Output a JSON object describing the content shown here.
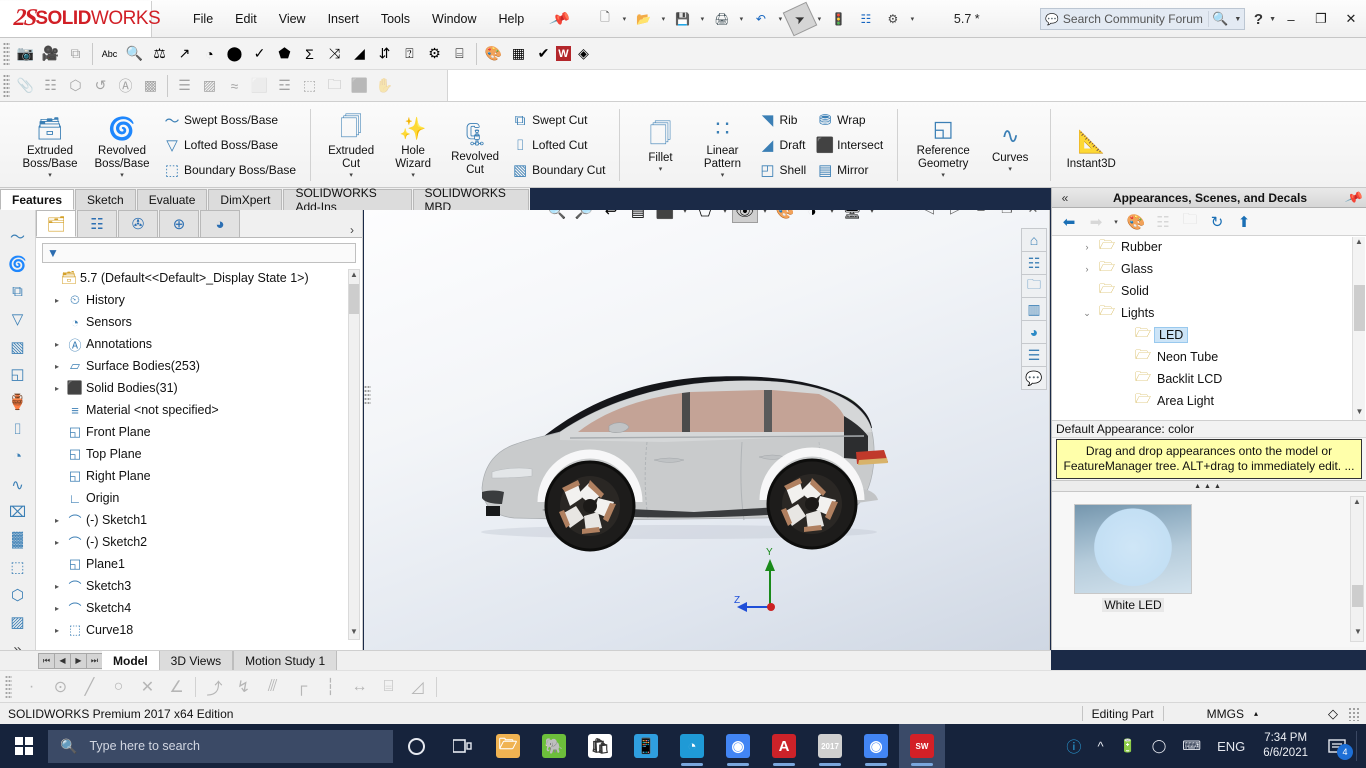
{
  "app": {
    "brand_ds": "2S",
    "brand_bold": "SOLID",
    "brand_light": "WORKS",
    "document_name": "5.7 *",
    "edition": "SOLIDWORKS Premium 2017 x64 Edition"
  },
  "menubar": {
    "items": [
      "File",
      "Edit",
      "View",
      "Insert",
      "Tools",
      "Window",
      "Help"
    ],
    "pin_icon": "pushpin-icon"
  },
  "quick_access": {
    "buttons": [
      {
        "name": "new-document",
        "icon": "new-file-icon",
        "caret": true
      },
      {
        "name": "open-document",
        "icon": "open-folder-icon",
        "caret": true
      },
      {
        "name": "save-document",
        "icon": "save-disk-icon",
        "caret": true
      },
      {
        "name": "print-document",
        "icon": "printer-icon",
        "caret": true
      },
      {
        "name": "undo",
        "icon": "undo-arrow-icon",
        "caret": true
      },
      {
        "name": "select",
        "icon": "cursor-arrow-icon",
        "caret": true,
        "selected": true
      },
      {
        "name": "rebuild",
        "icon": "traffic-light-icon",
        "caret": false
      },
      {
        "name": "file-properties",
        "icon": "properties-list-icon",
        "caret": false
      },
      {
        "name": "options",
        "icon": "gear-icon",
        "caret": true
      }
    ]
  },
  "search": {
    "placeholder": "Search Community Forum",
    "icon": "community-chat-icon",
    "magnifier": "magnifier-icon"
  },
  "window_controls": {
    "help": "?",
    "minimize": "–",
    "maximize": "❐",
    "close": "✕"
  },
  "toolbar_row1": [
    {
      "name": "capture-image-icon",
      "glyph": "📷",
      "dim": false
    },
    {
      "name": "record-video-icon",
      "glyph": "🎥",
      "dim": false
    },
    {
      "name": "copy-image-icon",
      "glyph": "⧉",
      "dim": true
    },
    {
      "name": "spell-checker-icon",
      "glyph": "Abc",
      "dim": false
    },
    {
      "name": "design-checker-icon",
      "glyph": "🔍",
      "dim": false
    },
    {
      "name": "compare-documents-icon",
      "glyph": "⚖",
      "dim": false
    },
    {
      "name": "import-diagnostics-icon",
      "glyph": "↗",
      "dim": false
    },
    {
      "name": "performance-evaluation-icon",
      "glyph": "◔",
      "dim": false
    },
    {
      "name": "mass-properties-icon",
      "glyph": "⬤",
      "dim": false
    },
    {
      "name": "check-entity-icon",
      "glyph": "✓",
      "dim": false
    },
    {
      "name": "geometry-analysis-icon",
      "glyph": "⬟",
      "dim": false
    },
    {
      "name": "measure-sum-icon",
      "glyph": "Σ",
      "dim": false
    },
    {
      "name": "deviation-analysis-icon",
      "glyph": "⤨",
      "dim": false
    },
    {
      "name": "draft-analysis-icon",
      "glyph": "◢",
      "dim": false
    },
    {
      "name": "symmetry-check-icon",
      "glyph": "⇵",
      "dim": false
    },
    {
      "name": "document-info-icon",
      "glyph": "⍰",
      "dim": false
    },
    {
      "name": "sensor-check-icon",
      "glyph": "⚙",
      "dim": false
    },
    {
      "name": "design-table-icon",
      "glyph": "⌸",
      "dim": false
    },
    {
      "name": "photoview-render-icon",
      "glyph": "🎨",
      "dim": false
    },
    {
      "name": "scene-illumination-icon",
      "glyph": "▦",
      "dim": false
    },
    {
      "name": "check-mark-icon",
      "glyph": "✔",
      "dim": false
    },
    {
      "name": "word-export-icon",
      "glyph": "W",
      "dim": false
    },
    {
      "name": "3d-interconnect-icon",
      "glyph": "◈",
      "dim": false
    }
  ],
  "toolbar_row2": [
    {
      "name": "attach-file-icon",
      "glyph": "📎"
    },
    {
      "name": "grid-layout-icon",
      "glyph": "☷"
    },
    {
      "name": "pattern-icon",
      "glyph": "⬡"
    },
    {
      "name": "cycle-icon",
      "glyph": "↺"
    },
    {
      "name": "annotate-icon",
      "glyph": "Ⓐ"
    },
    {
      "name": "texture-icon",
      "glyph": "▩"
    },
    {
      "name": "arrange-icon",
      "glyph": "☰"
    },
    {
      "name": "mesh-icon",
      "glyph": "▨"
    },
    {
      "name": "flow-icon",
      "glyph": "≈"
    },
    {
      "name": "page-icon",
      "glyph": "⬜"
    },
    {
      "name": "hierarchy-icon",
      "glyph": "☲"
    },
    {
      "name": "blank-page-icon",
      "glyph": "⬚"
    },
    {
      "name": "folder-icon",
      "glyph": "🗀"
    },
    {
      "name": "battery-icon",
      "glyph": "⬛"
    },
    {
      "name": "hand-tool-icon",
      "glyph": "✋"
    }
  ],
  "ribbon": {
    "groups": [
      {
        "name": "boss-base-group",
        "big": [
          {
            "name": "extruded-boss-base",
            "icon": "extrude-boss-icon",
            "label": "Extruded\nBoss/Base",
            "caret": true
          },
          {
            "name": "revolved-boss-base",
            "icon": "revolve-boss-icon",
            "label": "Revolved\nBoss/Base",
            "caret": true
          }
        ],
        "small": [
          {
            "name": "swept-boss-base",
            "icon": "swept-boss-icon",
            "label": "Swept Boss/Base"
          },
          {
            "name": "lofted-boss-base",
            "icon": "lofted-boss-icon",
            "label": "Lofted Boss/Base"
          },
          {
            "name": "boundary-boss-base",
            "icon": "boundary-boss-icon",
            "label": "Boundary Boss/Base"
          }
        ]
      },
      {
        "name": "cut-group",
        "big": [
          {
            "name": "extruded-cut",
            "icon": "extrude-cut-icon",
            "label": "Extruded\nCut",
            "caret": true
          },
          {
            "name": "hole-wizard",
            "icon": "hole-wizard-icon",
            "label": "Hole\nWizard",
            "caret": true
          },
          {
            "name": "revolved-cut",
            "icon": "revolve-cut-icon",
            "label": "Revolved\nCut",
            "caret": false
          }
        ],
        "small": [
          {
            "name": "swept-cut",
            "icon": "swept-cut-icon",
            "label": "Swept Cut"
          },
          {
            "name": "lofted-cut",
            "icon": "lofted-cut-icon",
            "label": "Lofted Cut"
          },
          {
            "name": "boundary-cut",
            "icon": "boundary-cut-icon",
            "label": "Boundary Cut"
          }
        ]
      },
      {
        "name": "feature-group",
        "big": [
          {
            "name": "fillet",
            "icon": "fillet-icon",
            "label": "Fillet",
            "caret": true
          },
          {
            "name": "linear-pattern",
            "icon": "linear-pattern-icon",
            "label": "Linear\nPattern",
            "caret": true
          }
        ],
        "small": [
          {
            "name": "rib",
            "icon": "rib-icon",
            "label": "Rib"
          },
          {
            "name": "draft",
            "icon": "draft-icon",
            "label": "Draft"
          },
          {
            "name": "shell",
            "icon": "shell-icon",
            "label": "Shell"
          }
        ],
        "small2": [
          {
            "name": "wrap",
            "icon": "wrap-icon",
            "label": "Wrap"
          },
          {
            "name": "intersect",
            "icon": "intersect-icon",
            "label": "Intersect"
          },
          {
            "name": "mirror",
            "icon": "mirror-icon",
            "label": "Mirror"
          }
        ]
      },
      {
        "name": "reference-group",
        "big": [
          {
            "name": "reference-geometry",
            "icon": "reference-plane-icon",
            "label": "Reference\nGeometry",
            "caret": true
          },
          {
            "name": "curves",
            "icon": "curves-icon",
            "label": "Curves",
            "caret": true
          }
        ]
      },
      {
        "name": "instant3d-group",
        "big": [
          {
            "name": "instant3d",
            "icon": "instant3d-icon",
            "label": "Instant3D",
            "caret": false
          }
        ]
      }
    ]
  },
  "command_tabs": {
    "items": [
      "Features",
      "Sketch",
      "Evaluate",
      "DimXpert",
      "SOLIDWORKS Add-Ins",
      "SOLIDWORKS MBD"
    ],
    "active": "Features"
  },
  "left_rail_icons": [
    "swept-boss-rail-icon",
    "revolved-rail-icon",
    "swept-cut-rail-icon",
    "lofted-rail-icon",
    "boundary-rail-icon",
    "plane-rail-icon",
    "revolve-thin-rail-icon",
    "loft-surface-rail-icon",
    "fill-surface-rail-icon",
    "sweep-surface-rail-icon",
    "delete-face-rail-icon",
    "thicken-rail-icon",
    "knit-surface-rail-icon",
    "move-face-rail-icon",
    "flex-rail-icon",
    "more-chevron-icon"
  ],
  "feature_manager": {
    "tabs": [
      {
        "name": "tab-feature-tree",
        "icon": "feature-tree-icon",
        "active": true
      },
      {
        "name": "tab-property-manager",
        "icon": "property-manager-icon",
        "active": false
      },
      {
        "name": "tab-configuration-manager",
        "icon": "configuration-icon",
        "active": false
      },
      {
        "name": "tab-dimxpert-manager",
        "icon": "dimxpert-icon",
        "active": false
      },
      {
        "name": "tab-display-manager",
        "icon": "display-manager-icon",
        "active": false
      }
    ],
    "chevron": "›",
    "filter_icon": "filter-funnel-icon",
    "filter_value": "",
    "tree": [
      {
        "label": "5.7 (Default<<Default>_Display State 1>)",
        "icon": "part-icon",
        "expand": "",
        "root": true
      },
      {
        "label": "History",
        "icon": "history-icon",
        "expand": "▸"
      },
      {
        "label": "Sensors",
        "icon": "sensors-icon",
        "expand": ""
      },
      {
        "label": "Annotations",
        "icon": "annotations-icon",
        "expand": "▸"
      },
      {
        "label": "Surface Bodies(253)",
        "icon": "surface-bodies-icon",
        "expand": "▸"
      },
      {
        "label": "Solid Bodies(31)",
        "icon": "solid-bodies-icon",
        "expand": "▸"
      },
      {
        "label": "Material <not specified>",
        "icon": "material-icon",
        "expand": ""
      },
      {
        "label": "Front Plane",
        "icon": "plane-icon",
        "expand": ""
      },
      {
        "label": "Top Plane",
        "icon": "plane-icon",
        "expand": ""
      },
      {
        "label": "Right Plane",
        "icon": "plane-icon",
        "expand": ""
      },
      {
        "label": "Origin",
        "icon": "origin-icon",
        "expand": ""
      },
      {
        "label": "(-) Sketch1",
        "icon": "sketch-icon",
        "expand": "▸"
      },
      {
        "label": "(-) Sketch2",
        "icon": "sketch-icon",
        "expand": "▸"
      },
      {
        "label": "Plane1",
        "icon": "plane-icon",
        "expand": ""
      },
      {
        "label": "Sketch3",
        "icon": "sketch-icon",
        "expand": "▸"
      },
      {
        "label": "Sketch4",
        "icon": "sketch-icon",
        "expand": "▸"
      },
      {
        "label": "Curve18",
        "icon": "curve-icon",
        "expand": "▸"
      }
    ]
  },
  "heads_up_view": {
    "buttons": [
      {
        "name": "zoom-to-fit-icon",
        "glyph": "🔍",
        "caret": false
      },
      {
        "name": "zoom-to-area-icon",
        "glyph": "🔎",
        "caret": false
      },
      {
        "name": "previous-view-icon",
        "glyph": "↩",
        "caret": false
      },
      {
        "name": "section-view-icon",
        "glyph": "▤",
        "caret": false
      },
      {
        "name": "view-orientation-icon",
        "glyph": "⬛",
        "caret": true
      },
      {
        "name": "display-style-icon",
        "glyph": "⬠",
        "caret": true
      },
      {
        "name": "hide-show-items-icon",
        "glyph": "👁",
        "caret": true,
        "selected": true
      },
      {
        "name": "edit-appearance-icon",
        "glyph": "🎨",
        "caret": false
      },
      {
        "name": "apply-scene-icon",
        "glyph": "◑",
        "caret": true
      },
      {
        "name": "view-settings-icon",
        "glyph": "🖥",
        "caret": true
      }
    ],
    "window_buttons": [
      {
        "name": "previous-doc-icon",
        "glyph": "◁"
      },
      {
        "name": "next-doc-icon",
        "glyph": "▷"
      },
      {
        "name": "minimize-doc-icon",
        "glyph": "–"
      },
      {
        "name": "restore-doc-icon",
        "glyph": "❐"
      },
      {
        "name": "close-doc-icon",
        "glyph": "✕"
      }
    ]
  },
  "viewport_rail": [
    {
      "name": "home-view-icon",
      "glyph": "⌂"
    },
    {
      "name": "appearance-library-icon",
      "glyph": "☷"
    },
    {
      "name": "design-library-icon",
      "glyph": "🗀"
    },
    {
      "name": "file-explorer-icon",
      "glyph": "▥"
    },
    {
      "name": "appearances-sphere-icon",
      "glyph": "◕"
    },
    {
      "name": "custom-properties-icon",
      "glyph": "☰"
    },
    {
      "name": "solidworks-forum-icon",
      "glyph": "💬"
    }
  ],
  "triad": {
    "y_label": "Y",
    "z_label": "Z"
  },
  "model": {
    "description": "silver hatchback electric car side view",
    "body_color": "#c9cbcc",
    "glass_color": "#c4a396",
    "roof_color": "#1a1a1a",
    "accent_green": "#9ab58e",
    "taillight_color": "#c0392b",
    "wheel_color": "#2a2724",
    "rim_color": "#b08060"
  },
  "task_pane": {
    "title": "Appearances, Scenes, and Decals",
    "collapse_icon": "double-chevron-left-icon",
    "pin_icon": "pushpin-icon",
    "toolbar": [
      {
        "name": "back-navigation-icon",
        "glyph": "⬅"
      },
      {
        "name": "forward-navigation-icon",
        "glyph": "➡",
        "dim": true
      },
      {
        "name": "history-dropdown-caret",
        "glyph": "▾",
        "caret": true
      },
      {
        "name": "edit-appearance-icon",
        "glyph": "🎨"
      },
      {
        "name": "view-list-icon",
        "glyph": "☷",
        "dim": true
      },
      {
        "name": "new-folder-icon",
        "glyph": "🗀",
        "dim": true
      },
      {
        "name": "refresh-icon",
        "glyph": "↻"
      },
      {
        "name": "up-one-level-icon",
        "glyph": "⬆"
      }
    ],
    "list": [
      {
        "label": "Rubber",
        "expand": "›",
        "indent": false,
        "selected": false
      },
      {
        "label": "Glass",
        "expand": "›",
        "indent": false,
        "selected": false
      },
      {
        "label": "Solid",
        "expand": "",
        "indent": false,
        "selected": false
      },
      {
        "label": "Lights",
        "expand": "⌄",
        "indent": false,
        "selected": false
      },
      {
        "label": "LED",
        "expand": "",
        "indent": true,
        "selected": true
      },
      {
        "label": "Neon Tube",
        "expand": "",
        "indent": true,
        "selected": false
      },
      {
        "label": "Backlit LCD",
        "expand": "",
        "indent": true,
        "selected": false
      },
      {
        "label": "Area Light",
        "expand": "",
        "indent": true,
        "selected": false
      }
    ],
    "default_appearance": "Default Appearance: color",
    "tip": "Drag and drop appearances onto the model or FeatureManager tree.  ALT+drag to immediately edit. ...",
    "gallery": [
      {
        "name": "white-led-swatch",
        "label": "White LED",
        "selected": true
      }
    ]
  },
  "bottom_tabs": {
    "pager": [
      "⏮",
      "◀",
      "▶",
      "⏭"
    ],
    "items": [
      {
        "label": "Model",
        "active": true
      },
      {
        "label": "3D Views",
        "active": false
      },
      {
        "label": "Motion Study 1",
        "active": false
      }
    ]
  },
  "sketch_bar": [
    {
      "name": "point-tool-icon",
      "glyph": "·"
    },
    {
      "name": "circle-tool-icon",
      "glyph": "⊙"
    },
    {
      "name": "line-tool-icon",
      "glyph": "╱"
    },
    {
      "name": "ellipse-tool-icon",
      "glyph": "○"
    },
    {
      "name": "trim-tool-icon",
      "glyph": "✕"
    },
    {
      "name": "extend-tool-icon",
      "glyph": "∠"
    },
    {
      "name": "arc-tool-icon",
      "glyph": "⤴"
    },
    {
      "name": "fillet-sketch-icon",
      "glyph": "↯"
    },
    {
      "name": "offset-entities-icon",
      "glyph": "⫻"
    },
    {
      "name": "rectangle-tool-icon",
      "glyph": "┌"
    },
    {
      "name": "construction-line-icon",
      "glyph": "┆"
    },
    {
      "name": "smart-dimension-icon",
      "glyph": "↔"
    },
    {
      "name": "grid-tool-icon",
      "glyph": "⌸"
    },
    {
      "name": "angle-tool-icon",
      "glyph": "◿"
    }
  ],
  "status_bar": {
    "edition": "SOLIDWORKS Premium 2017 x64 Edition",
    "editing_state": "Editing Part",
    "units": "MMGS",
    "units_caret": "▴",
    "overlay_icon": "layers-icon"
  },
  "taskbar": {
    "start_icon": "windows-start-icon",
    "search_placeholder": "Type here to search",
    "search_icon": "magnifier-icon",
    "cortana_icon": "cortana-circle-icon",
    "taskview_icon": "task-view-icon",
    "apps": [
      {
        "name": "file-explorer-taskbar-icon",
        "glyph": "🗁",
        "color": "#f0b352",
        "running": false
      },
      {
        "name": "evernote-taskbar-icon",
        "glyph": "🐘",
        "color": "#6cbf3b",
        "running": false
      },
      {
        "name": "microsoft-store-taskbar-icon",
        "glyph": "🛍",
        "color": "#ffffff",
        "running": false
      },
      {
        "name": "your-phone-taskbar-icon",
        "glyph": "📱",
        "color": "#2f9fe0",
        "running": false
      },
      {
        "name": "microsoft-edge-taskbar-icon",
        "glyph": "◔",
        "color": "#1f9ad6",
        "running": true
      },
      {
        "name": "google-chrome-taskbar-icon",
        "glyph": "◉",
        "color": "#4285f4",
        "running": true
      },
      {
        "name": "adobe-acrobat-taskbar-icon",
        "glyph": "A",
        "color": "#cc2229",
        "running": true
      },
      {
        "name": "solidworks-2017-taskbar-icon",
        "glyph": "2017",
        "color": "#cfcfcf",
        "running": true
      },
      {
        "name": "google-chrome-2-taskbar-icon",
        "glyph": "◉",
        "color": "#4285f4",
        "running": true
      },
      {
        "name": "solidworks-active-taskbar-icon",
        "glyph": "SW",
        "color": "#d32027",
        "running": true,
        "active": true
      }
    ],
    "tray": [
      {
        "name": "action-needed-icon",
        "glyph": "?"
      },
      {
        "name": "show-hidden-icons-chevron",
        "glyph": "∧"
      },
      {
        "name": "battery-icon",
        "glyph": "🔌"
      },
      {
        "name": "wifi-icon",
        "glyph": "◡"
      },
      {
        "name": "keyboard-icon",
        "glyph": "⌨"
      },
      {
        "name": "language-indicator",
        "glyph": "ENG"
      }
    ],
    "clock_time": "7:34 PM",
    "clock_date": "6/6/2021",
    "notification_icon": "action-center-icon",
    "notification_count": "4"
  }
}
